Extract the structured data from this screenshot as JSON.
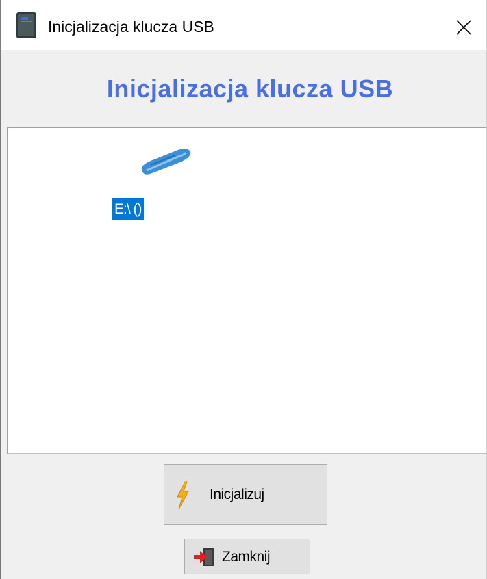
{
  "window": {
    "title": "Inicjalizacja klucza USB"
  },
  "header": {
    "title": "Inicjalizacja klucza USB"
  },
  "drives": [
    {
      "label": "E:\\ ()",
      "icon": "usb-drive-icon",
      "selected": true
    }
  ],
  "buttons": {
    "initialize_label": "Inicjalizuj",
    "close_label": "Zamknij"
  },
  "colors": {
    "header_title": "#4a6fe0",
    "selection": "#0078d7",
    "usb_icon": "#3a8fd8"
  }
}
